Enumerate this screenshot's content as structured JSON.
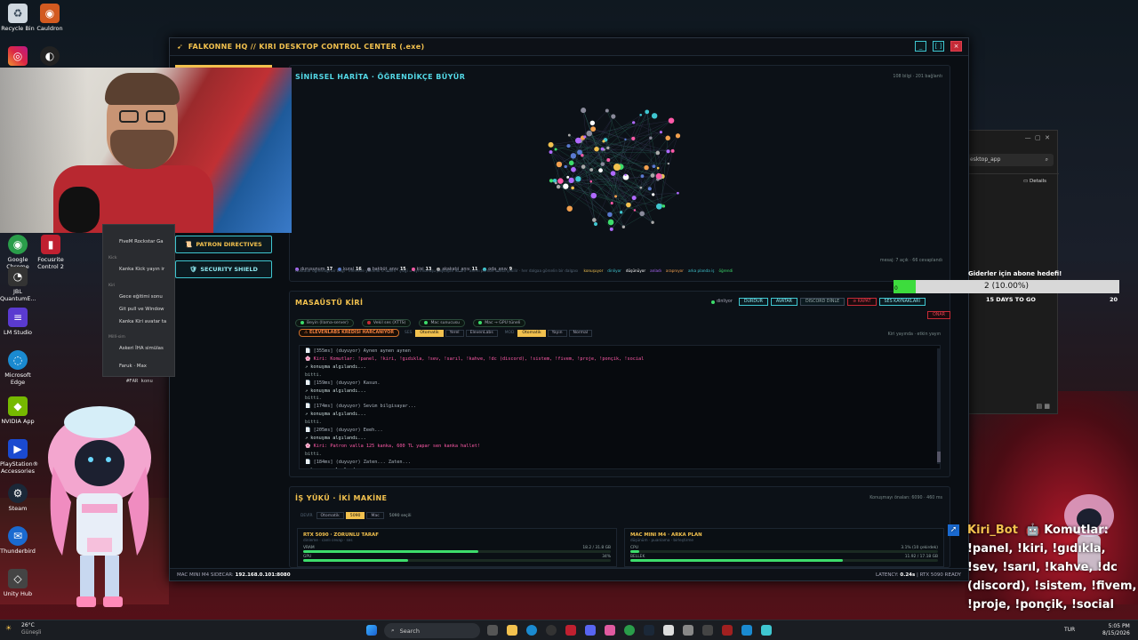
{
  "desktop": {
    "icons_top": [
      {
        "label": "Recycle Bin",
        "icon": "recycle-bin-icon",
        "color": "#cfd8e0"
      },
      {
        "label": "Cauldron",
        "icon": "cauldron-icon",
        "color": "#d25a20"
      }
    ],
    "icons_left": [
      {
        "label": "Google Chrome",
        "icon": "chrome-icon",
        "color": "#2a9d4a"
      },
      {
        "label": "JBL QuantumE...",
        "icon": "jbl-icon",
        "color": "#333"
      },
      {
        "label": "LM Studio",
        "icon": "lm-studio-icon",
        "color": "#5a3ad0"
      },
      {
        "label": "Microsoft Edge",
        "icon": "edge-icon",
        "color": "#1a8ad0"
      },
      {
        "label": "NVIDIA App",
        "icon": "nvidia-icon",
        "color": "#76b900"
      },
      {
        "label": "PlayStation® Accessories",
        "icon": "playstation-icon",
        "color": "#1a4ad0"
      },
      {
        "label": "Steam",
        "icon": "steam-icon",
        "color": "#1b2838"
      },
      {
        "label": "Thunderbird",
        "icon": "thunderbird-icon",
        "color": "#1a6ad0"
      },
      {
        "label": "Unity Hub",
        "icon": "unity-icon",
        "color": "#444"
      }
    ],
    "focusrite": "Focusrite Control 2"
  },
  "window": {
    "title": "FALKONNE HQ // KIRI DESKTOP CONTROL CENTER (.exe)",
    "min": "_",
    "max": "[ ]",
    "close": "×"
  },
  "sidebar": {
    "patron": "PATRON DIRECTIVES",
    "security": "SECURITY SHIELD"
  },
  "map": {
    "title": "SİNİRSEL HARİTA · ÖĞRENDİKÇE BÜYÜR",
    "stats": "108 bilgi · 201 bağlantı",
    "legend": [
      {
        "label": "durusunum",
        "count": "17",
        "color": "#b06aff"
      },
      {
        "label": "kural",
        "count": "16",
        "color": "#5a7ad0"
      },
      {
        "label": "bakbüt_anıv",
        "count": "15",
        "color": "#8a8a9a"
      },
      {
        "label": "kisi",
        "count": "13",
        "color": "#ff5aa8"
      },
      {
        "label": "akakatıi_anıv",
        "count": "11",
        "color": "#aaaaaa"
      },
      {
        "label": "oda_anıv",
        "count": "9",
        "color": "#3fc6d0"
      }
    ],
    "footer_right": "mesaj: 7 açık · 66 cevaplandı",
    "hint": "Noktalar öğrendiği bir bilgi · merkeze yakınlık = önem · çizgi = aynı konuşu paylaşan iki anı · anımı pembe nokta çekilir · her dalgaa görselin bir dalgası",
    "states": [
      {
        "label": "konuşuyor",
        "color": "#f2c14e"
      },
      {
        "label": "dinliyor",
        "color": "#3fc6d0"
      },
      {
        "label": "düşünüyor",
        "color": "#ffffff"
      },
      {
        "label": "anladı",
        "color": "#b06aff"
      },
      {
        "label": "arapnıyor",
        "color": "#f2a04e"
      },
      {
        "label": "arka planda iş",
        "color": "#3fc6d0"
      },
      {
        "label": "öğrendi",
        "color": "#3ddc6b"
      }
    ]
  },
  "desk": {
    "title": "MASAÜSTÜ KİRİ",
    "status": "dinliyor",
    "buttons": [
      "DURDUR",
      "AVATAR",
      "DISCORD DİNLE",
      "⊘ KAPAT",
      "SES KAYNAKLARI",
      "ONAR"
    ],
    "chips": [
      "Beyin (llama-server)",
      "Vekil ses (XTTS)",
      "Mac sunucusu",
      "Mac → GPU tüneli"
    ],
    "warn": "⚠ ELEVENLABS KREDİSİ HARCANIYOR",
    "ses_label": "SES",
    "ses_opts": [
      "Otomatik",
      "Yerel",
      "ElevenLabs"
    ],
    "mod_label": "MOD",
    "mod_opts": [
      "Otomatik",
      "Yayın",
      "Normal"
    ],
    "right_hint": "Kiri yayında · etkin yayın",
    "console": [
      {
        "t": "📄 [355ms] (duyuyor) Aynen aynen aynen",
        "c": "heard"
      },
      {
        "t": "🌸 Kiri: Komutlar: !panel, !kiri, !gıdıkla, !sev, !sarıl, !kahve, !dc (discord), !sistem, !fivem, !proje, !ponçik, !social",
        "c": "kiri"
      },
      {
        "t": "↗ konuşma algılandı...",
        "c": "heard2"
      },
      {
        "t": "  bitti.",
        "c": "done"
      },
      {
        "t": "📄 [159ms] (duyuyor) Kasun.",
        "c": "heard"
      },
      {
        "t": "↗ konuşma algılandı...",
        "c": "heard2"
      },
      {
        "t": "  bitti.",
        "c": "done"
      },
      {
        "t": "📄 [174ms] (duyuyor) Sevim bilgisayar...",
        "c": "heard"
      },
      {
        "t": "↗ konuşma algılandı...",
        "c": "heard2"
      },
      {
        "t": "  bitti.",
        "c": "done"
      },
      {
        "t": "📄 [205ms] (duyuyor) Eeeh...",
        "c": "heard"
      },
      {
        "t": "↗ konuşma algılandı...",
        "c": "heard2"
      },
      {
        "t": "🌸 Kiri: Patron valla 125 kanka, 600 TL yapar sen kanka hallet!",
        "c": "kiri"
      },
      {
        "t": "  bitti.",
        "c": "done"
      },
      {
        "t": "📄 [184ms] (duyuyor) Zaten... Zaten...",
        "c": "heard"
      },
      {
        "t": "↗ konuşma algılandı...",
        "c": "heard2"
      }
    ]
  },
  "work": {
    "title": "İŞ YÜKÜ · İKİ MAKİNE",
    "right": "Konuşmayı önalan: 6090 · 460 ms",
    "devir_label": "DEVİR",
    "opts": [
      "Otomatik",
      "5090",
      "Mac"
    ],
    "selected": "5090 seçili",
    "rtx": {
      "title": "RTX 5090 · ZORUNLU TARAF",
      "sub": "dinleme · canlı cevap · ses",
      "vram_label": "VRAM",
      "vram_val": "18.2 / 31.8 GB",
      "vram_frac": 0.57,
      "gpu_label": "GPU",
      "gpu_val": "34%",
      "gpu_frac": 0.34
    },
    "mac": {
      "title": "MAC MINI M4 · ARKA PLAN",
      "sub": "düşünüm · puanlama · birleştirme",
      "cpu_label": "CPU",
      "cpu_val": "3.1% (10 çekirdek)",
      "cpu_frac": 0.03,
      "mem_label": "BELLEK",
      "mem_val": "11.92 / 17.18 GB",
      "mem_frac": 0.69
    }
  },
  "statusbar": {
    "left_label": "MAC MINI M4 SIDECAR:",
    "left_val": "192.168.0.101:8080",
    "right_label": "LATENCY:",
    "right_val": "0.24s",
    "right_tail": "| RTX 5090 READY"
  },
  "ctxmenu": {
    "items": [
      {
        "t": "FiveM Rockstar Ga",
        "kind": "item"
      },
      {
        "t": "Kick",
        "kind": "head"
      },
      {
        "t": "Kanka Kick yayın ir",
        "kind": "item"
      },
      {
        "t": "Kiri",
        "kind": "head"
      },
      {
        "t": "Gece eğitimi sonu",
        "kind": "item"
      },
      {
        "t": "Git pull ve Window",
        "kind": "item"
      },
      {
        "t": "Kanka Kiri avatar ta",
        "kind": "item"
      },
      {
        "t": "Millî-sim",
        "kind": "head"
      },
      {
        "t": "Askeri İHA simülas",
        "kind": "item"
      },
      {
        "t": "Faruk · Max",
        "kind": "item"
      }
    ],
    "partial": "#FAR konu"
  },
  "explorer": {
    "path": "esktop_app",
    "details": "Details"
  },
  "goal": {
    "title": "Giderler için abone hedefi!",
    "left_num": "0",
    "value": "2 (10.00%)",
    "fraction": 0.1,
    "days": "15 DAYS TO GO",
    "right_num": "20"
  },
  "chat": {
    "user": "Kiri_Bot",
    "message": "Komutlar: !panel, !kiri, !gıdıkla, !sev, !sarıl, !kahve, !dc (discord), !sistem, !fivem, !proje, !ponçik, !social"
  },
  "taskbar": {
    "weather_temp": "26°C",
    "weather_text": "Güneşli",
    "search": "Search",
    "lang": "TUR",
    "time": "5:05 PM",
    "date": "8/15/2026"
  }
}
